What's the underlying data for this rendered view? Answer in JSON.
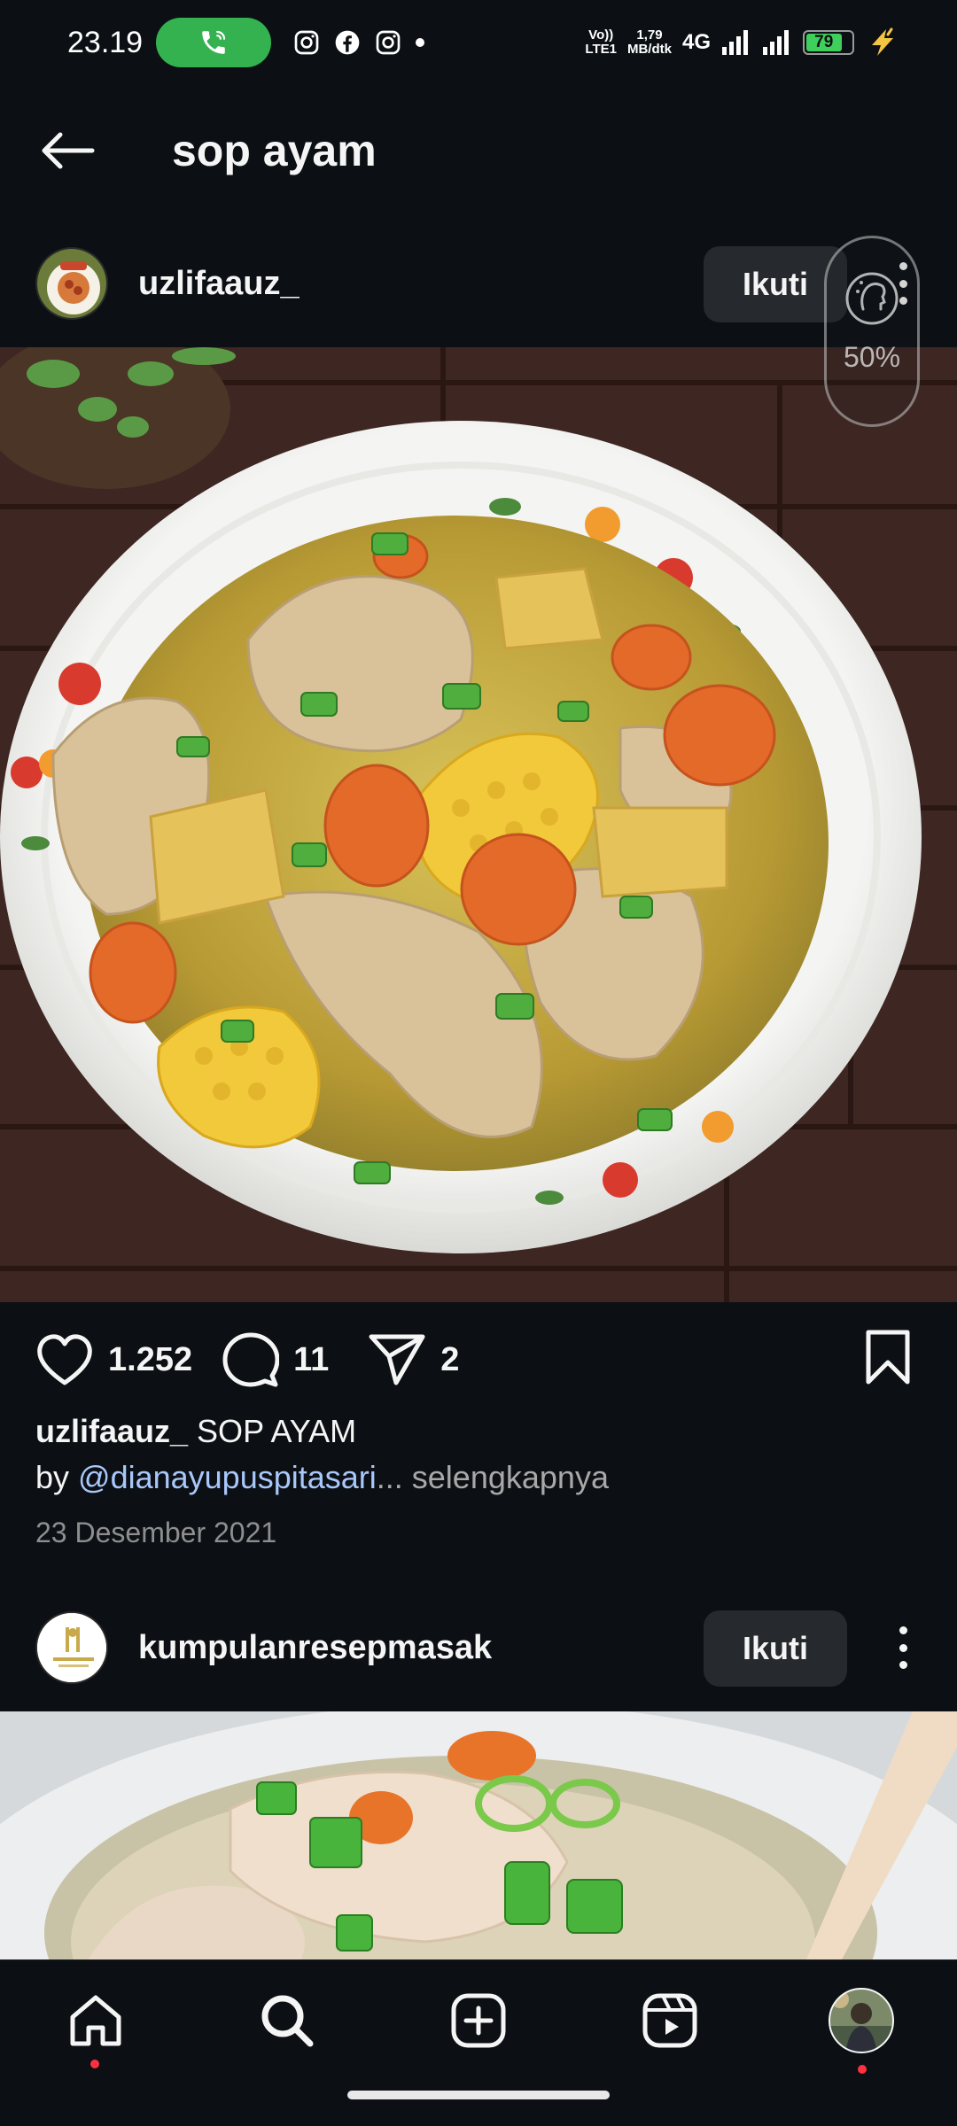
{
  "status_bar": {
    "time": "23.19",
    "network_top": "Vo))",
    "network_bottom": "LTE1",
    "speed_value": "1,79",
    "speed_unit": "MB/dtk",
    "network_type": "4G",
    "battery_level": "79",
    "notification_icons": [
      "instagram-icon",
      "facebook-icon",
      "instagram-icon",
      "dot-icon"
    ]
  },
  "header": {
    "title": "sop ayam"
  },
  "post1": {
    "username": "uzlifaauz_",
    "follow_label": "Ikuti",
    "likes": "1.252",
    "comments": "11",
    "shares": "2",
    "caption_user": "uzlifaauz_",
    "caption_text": " SOP AYAM",
    "caption_by": "by ",
    "caption_mention": "@dianayupuspitasari",
    "caption_more": "... selengkapnya",
    "date": "23 Desember 2021"
  },
  "comfort_overlay": {
    "percent": "50%"
  },
  "post2": {
    "username": "kumpulanresepmasak",
    "follow_label": "Ikuti"
  },
  "colors": {
    "background": "#0c1014",
    "follow_button": "#262a2e",
    "mention": "#a8c7fa",
    "call_pill": "#34b24f",
    "notification_dot": "#ff3040"
  },
  "bottom_nav": {
    "items": [
      "home-icon",
      "search-icon",
      "create-icon",
      "reels-icon",
      "profile-avatar"
    ]
  }
}
